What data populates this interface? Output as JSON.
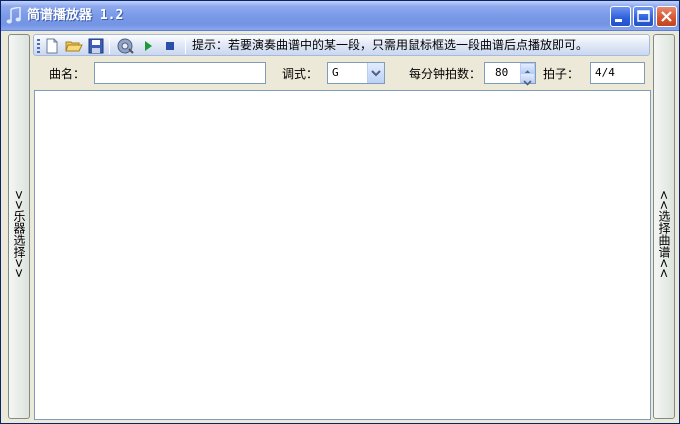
{
  "window": {
    "title": "简谱播放器 1.2",
    "buttons": [
      "minimize-icon",
      "maximize-icon",
      "close-icon"
    ]
  },
  "left_panel": {
    "label": ">>乐器选择>>"
  },
  "right_panel": {
    "label": "<<选择曲谱<<"
  },
  "toolbar": {
    "tools": [
      "new-file-icon",
      "open-folder-icon",
      "save-icon",
      "settings-icon",
      "play-icon",
      "stop-icon"
    ],
    "hint": "提示：若要演奏曲谱中的某一段，只需用鼠标框选一段曲谱后点播放即可。"
  },
  "form": {
    "song_label": "曲名：",
    "song_value": "",
    "key_label": "调式：",
    "key_value": "G",
    "tempo_label": "每分钟拍数：",
    "tempo_value": "80",
    "beat_label": "拍子：",
    "beat_value": "4/4"
  },
  "colors": {
    "title_gradient": "#7b9be8",
    "close_button": "#d2552f",
    "play_green": "#1f9a3a",
    "stop_blue": "#2b4fa8"
  }
}
